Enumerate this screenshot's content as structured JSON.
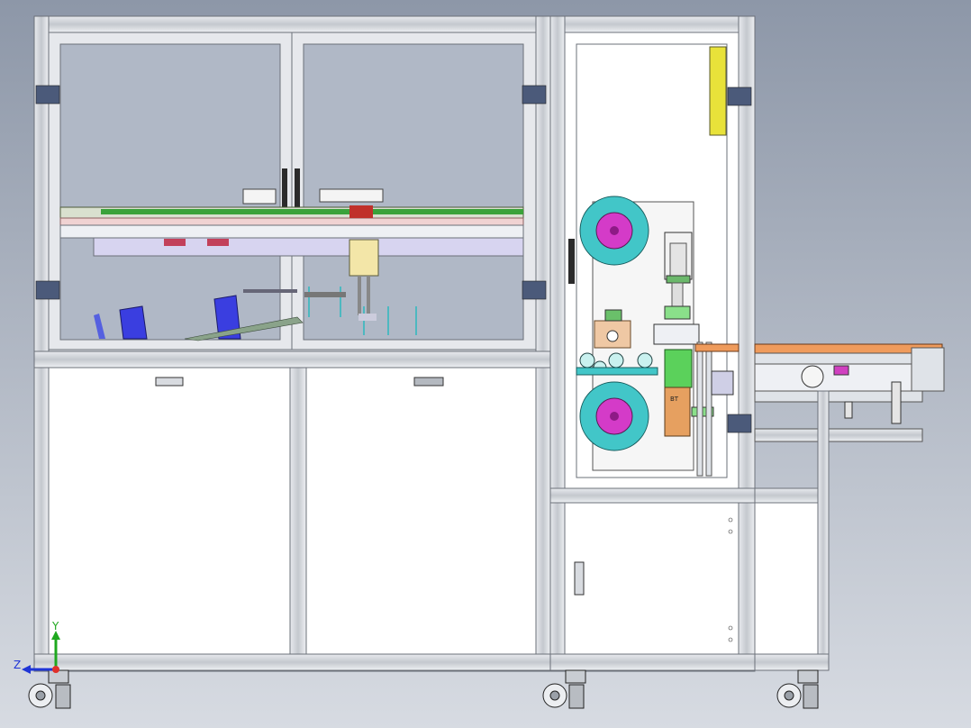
{
  "viewport": {
    "background_top": "#8d97a8",
    "background_bottom": "#d7dbe2"
  },
  "colors": {
    "frame": "#c9cdd3",
    "frame_edge": "#6b7079",
    "glass": "#b0b8c6",
    "panel": "#ffffff",
    "cyan_roll": "#42c6c8",
    "magenta_core": "#d43bc8",
    "green_part": "#5bd15b",
    "orange_part": "#e6a060",
    "blue_part": "#3a3ee0",
    "lavender": "#d7d4f0",
    "yellow_strip": "#e8e23a"
  },
  "triad": {
    "y_label": "Y",
    "z_label": "Z",
    "y_color": "#1fa81f",
    "z_color": "#1f35d6",
    "origin_color": "#e0302a"
  },
  "parts": {
    "label_tag": "BT"
  }
}
